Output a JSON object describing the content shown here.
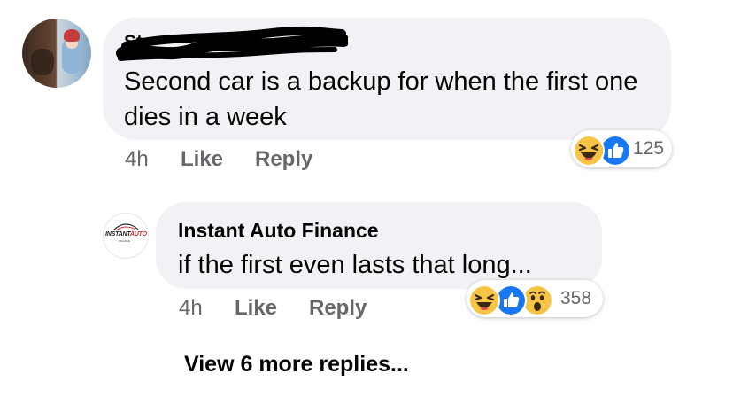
{
  "comment1": {
    "author": "St",
    "text": "Second car is a backup for when the first one dies in a week",
    "time": "4h",
    "like_label": "Like",
    "reply_label": "Reply",
    "reaction_count": "125",
    "reactions": [
      "haha-icon",
      "like-icon"
    ]
  },
  "reply1": {
    "author": "Instant Auto Finance",
    "logo_text_a": "INSTANT",
    "logo_text_b": "AUTO",
    "logo_sub": "FINANCE",
    "text": "if the first even lasts that long...",
    "time": "4h",
    "like_label": "Like",
    "reply_label": "Reply",
    "reaction_count": "358",
    "reactions": [
      "haha-icon",
      "like-icon",
      "wow-icon"
    ]
  },
  "view_more": "View 6 more replies...",
  "colors": {
    "bubble": "#f0f2f5",
    "meta_text": "#65676b",
    "like_blue": "#1877f2",
    "emoji_yellow": "#f7c445"
  }
}
